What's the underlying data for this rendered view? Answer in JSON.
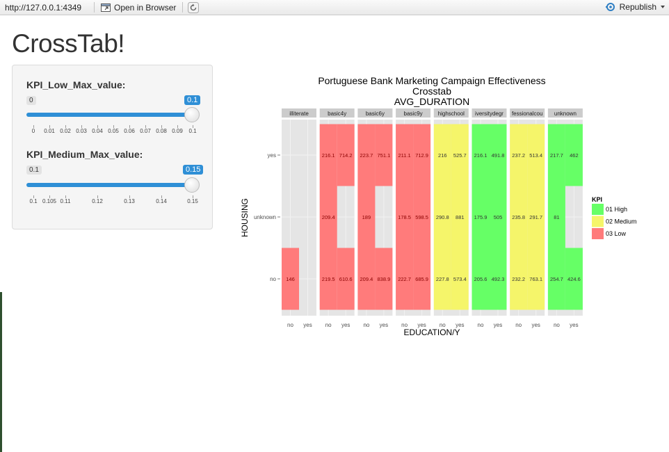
{
  "toolbar": {
    "url": "http://127.0.0.1:4349",
    "open_label": "Open in Browser",
    "republish_label": "Republish"
  },
  "app": {
    "title": "CrossTab!"
  },
  "sliders": [
    {
      "label": "KPI_Low_Max_value:",
      "min": "0",
      "max": "0.1",
      "value": "0.1",
      "ticks": [
        "0",
        "0.01",
        "0.02",
        "0.03",
        "0.04",
        "0.05",
        "0.06",
        "0.07",
        "0.08",
        "0.09",
        "0.1"
      ]
    },
    {
      "label": "KPI_Medium_Max_value:",
      "min": "0.1",
      "max": "0.15",
      "value": "0.15",
      "ticks": [
        "0.1",
        "0.105",
        "0.11",
        "0.12",
        "0.13",
        "0.14",
        "0.15"
      ]
    }
  ],
  "colors": {
    "accent": "#2f8fd6",
    "high": "#66ff66",
    "medium": "#f5f56a",
    "low": "#ff7b7b",
    "panel_bg": "#e5e5e5",
    "strip_bg": "#cccccc"
  },
  "chart_data": {
    "type": "heatmap",
    "title_lines": [
      "Portuguese Bank Marketing Campaign Effectiveness",
      "Crosstab",
      "AVG_DURATION"
    ],
    "xlabel": "EDUCATION/Y",
    "ylabel": "HOUSING",
    "facets": [
      "illiterate",
      "basic4y",
      "basic6y",
      "basic9y",
      "highschool",
      "iversitydegr",
      "fessionalcou",
      "unknown"
    ],
    "x_categories": [
      "no",
      "yes"
    ],
    "y_categories": [
      "no",
      "unknown",
      "yes"
    ],
    "legend": {
      "title": "KPI",
      "items": [
        "01 High",
        "02 Medium",
        "03 Low"
      ]
    },
    "cells": [
      {
        "facet": "illiterate",
        "y": "no",
        "x": "no",
        "value": 146,
        "kpi": "03 Low"
      },
      {
        "facet": "basic4y",
        "y": "yes",
        "x": "no",
        "value": 216.1,
        "kpi": "03 Low"
      },
      {
        "facet": "basic4y",
        "y": "yes",
        "x": "yes",
        "value": 714.2,
        "kpi": "03 Low"
      },
      {
        "facet": "basic4y",
        "y": "unknown",
        "x": "no",
        "value": 209.4,
        "kpi": "03 Low"
      },
      {
        "facet": "basic4y",
        "y": "no",
        "x": "no",
        "value": 219.5,
        "kpi": "03 Low"
      },
      {
        "facet": "basic4y",
        "y": "no",
        "x": "yes",
        "value": 610.6,
        "kpi": "03 Low"
      },
      {
        "facet": "basic6y",
        "y": "yes",
        "x": "no",
        "value": 223.7,
        "kpi": "03 Low"
      },
      {
        "facet": "basic6y",
        "y": "yes",
        "x": "yes",
        "value": 751.1,
        "kpi": "03 Low"
      },
      {
        "facet": "basic6y",
        "y": "unknown",
        "x": "no",
        "value": 189,
        "kpi": "03 Low"
      },
      {
        "facet": "basic6y",
        "y": "no",
        "x": "no",
        "value": 209.4,
        "kpi": "03 Low"
      },
      {
        "facet": "basic6y",
        "y": "no",
        "x": "yes",
        "value": 838.9,
        "kpi": "03 Low"
      },
      {
        "facet": "basic9y",
        "y": "yes",
        "x": "no",
        "value": 211.1,
        "kpi": "03 Low"
      },
      {
        "facet": "basic9y",
        "y": "yes",
        "x": "yes",
        "value": 712.9,
        "kpi": "03 Low"
      },
      {
        "facet": "basic9y",
        "y": "unknown",
        "x": "no",
        "value": 178.5,
        "kpi": "03 Low"
      },
      {
        "facet": "basic9y",
        "y": "unknown",
        "x": "yes",
        "value": 598.5,
        "kpi": "03 Low"
      },
      {
        "facet": "basic9y",
        "y": "no",
        "x": "no",
        "value": 222.7,
        "kpi": "03 Low"
      },
      {
        "facet": "basic9y",
        "y": "no",
        "x": "yes",
        "value": 685.9,
        "kpi": "03 Low"
      },
      {
        "facet": "highschool",
        "y": "yes",
        "x": "no",
        "value": 216,
        "kpi": "02 Medium"
      },
      {
        "facet": "highschool",
        "y": "yes",
        "x": "yes",
        "value": 525.7,
        "kpi": "02 Medium"
      },
      {
        "facet": "highschool",
        "y": "unknown",
        "x": "no",
        "value": 290.8,
        "kpi": "02 Medium"
      },
      {
        "facet": "highschool",
        "y": "unknown",
        "x": "yes",
        "value": 881,
        "kpi": "02 Medium"
      },
      {
        "facet": "highschool",
        "y": "no",
        "x": "no",
        "value": 227.8,
        "kpi": "02 Medium"
      },
      {
        "facet": "highschool",
        "y": "no",
        "x": "yes",
        "value": 573.4,
        "kpi": "02 Medium"
      },
      {
        "facet": "iversitydegr",
        "y": "yes",
        "x": "no",
        "value": 216.1,
        "kpi": "01 High"
      },
      {
        "facet": "iversitydegr",
        "y": "yes",
        "x": "yes",
        "value": 491.8,
        "kpi": "01 High"
      },
      {
        "facet": "iversitydegr",
        "y": "unknown",
        "x": "no",
        "value": 175.9,
        "kpi": "01 High"
      },
      {
        "facet": "iversitydegr",
        "y": "unknown",
        "x": "yes",
        "value": 505,
        "kpi": "01 High"
      },
      {
        "facet": "iversitydegr",
        "y": "no",
        "x": "no",
        "value": 205.6,
        "kpi": "01 High"
      },
      {
        "facet": "iversitydegr",
        "y": "no",
        "x": "yes",
        "value": 492.3,
        "kpi": "01 High"
      },
      {
        "facet": "fessionalcou",
        "y": "yes",
        "x": "no",
        "value": 237.2,
        "kpi": "02 Medium"
      },
      {
        "facet": "fessionalcou",
        "y": "yes",
        "x": "yes",
        "value": 513.4,
        "kpi": "02 Medium"
      },
      {
        "facet": "fessionalcou",
        "y": "unknown",
        "x": "no",
        "value": 235.8,
        "kpi": "02 Medium"
      },
      {
        "facet": "fessionalcou",
        "y": "unknown",
        "x": "yes",
        "value": 291.7,
        "kpi": "02 Medium"
      },
      {
        "facet": "fessionalcou",
        "y": "no",
        "x": "no",
        "value": 232.2,
        "kpi": "02 Medium"
      },
      {
        "facet": "fessionalcou",
        "y": "no",
        "x": "yes",
        "value": 763.1,
        "kpi": "02 Medium"
      },
      {
        "facet": "unknown",
        "y": "yes",
        "x": "no",
        "value": 217.7,
        "kpi": "01 High"
      },
      {
        "facet": "unknown",
        "y": "yes",
        "x": "yes",
        "value": 462,
        "kpi": "01 High"
      },
      {
        "facet": "unknown",
        "y": "unknown",
        "x": "no",
        "value": 81,
        "kpi": "01 High"
      },
      {
        "facet": "unknown",
        "y": "no",
        "x": "no",
        "value": 254.7,
        "kpi": "01 High"
      },
      {
        "facet": "unknown",
        "y": "no",
        "x": "yes",
        "value": 424.6,
        "kpi": "01 High"
      }
    ]
  }
}
